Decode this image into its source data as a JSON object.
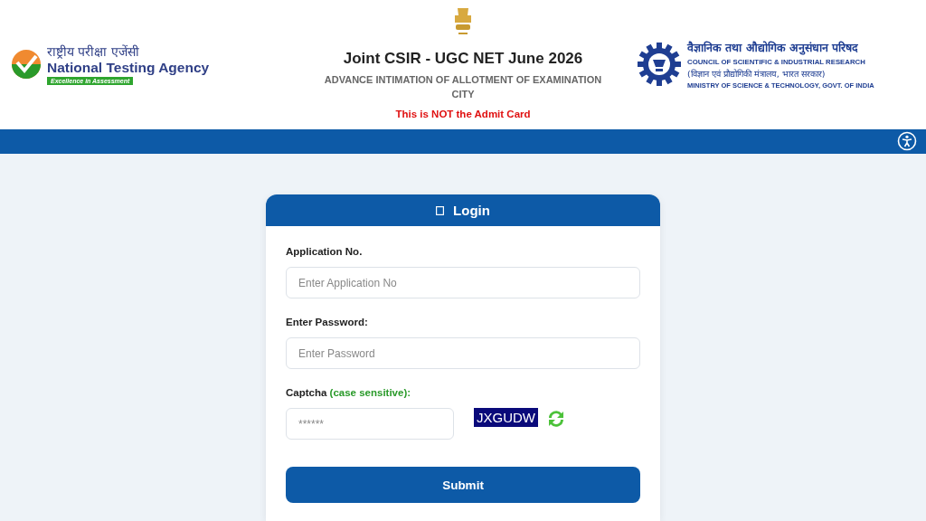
{
  "nta_logo": {
    "hindi": "राष्ट्रीय परीक्षा एजेंसी",
    "english": "National Testing Agency",
    "tagline": "Excellence in Assessment"
  },
  "header": {
    "title": "Joint CSIR - UGC NET June 2026",
    "subtitle": "ADVANCE INTIMATION OF ALLOTMENT OF EXAMINATION CITY",
    "notice": "This is NOT the Admit Card"
  },
  "csir_logo": {
    "hindi": "वैज्ञानिक तथा औद्योगिक अनुसंधान परिषद",
    "english": "COUNCIL OF SCIENTIFIC & INDUSTRIAL RESEARCH",
    "hindi_ministry": "(विज्ञान एवं प्रौद्योगिकी मंत्रालय, भारत सरकार)",
    "ministry": "MINISTRY OF SCIENCE & TECHNOLOGY, GOVT. OF INDIA"
  },
  "login": {
    "title": "Login",
    "fields": [
      {
        "label": "Application No.",
        "placeholder": "Enter Application No"
      },
      {
        "label": "Enter Password:",
        "placeholder": "Enter Password"
      }
    ],
    "captcha": {
      "label": "Captcha",
      "hint": "(case sensitive):",
      "placeholder": "******",
      "code": "JXGUDW"
    },
    "submit": "Submit"
  }
}
